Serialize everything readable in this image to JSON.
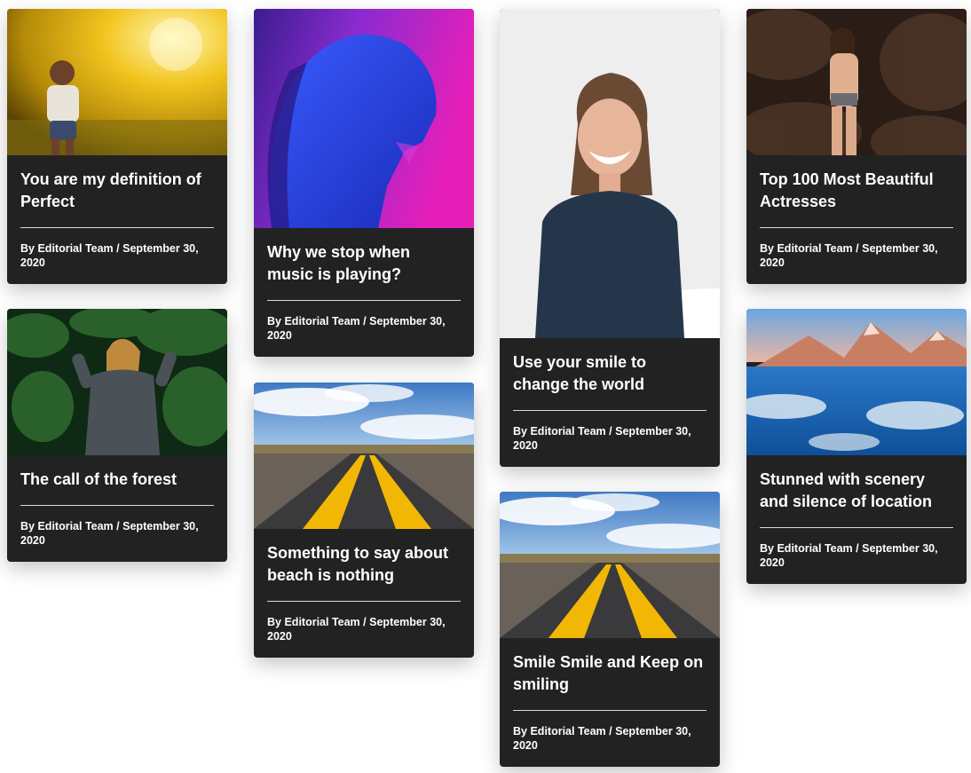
{
  "posts": [
    {
      "title": "You are my definition of Perfect",
      "author_prefix": "By",
      "author": "Editorial Team",
      "separator": "/",
      "date": "September 30, 2020",
      "image": "child-sprinkler-photo"
    },
    {
      "title": "Why we stop when music is playing?",
      "author_prefix": "By",
      "author": "Editorial Team",
      "separator": "/",
      "date": "September 30, 2020",
      "image": "neon-portrait-photo"
    },
    {
      "title": "Use your smile to change the world",
      "author_prefix": "By",
      "author": "Editorial Team",
      "separator": "/",
      "date": "September 30, 2020",
      "image": "smiling-woman-photo"
    },
    {
      "title": "Top 100 Most Beautiful Actresses",
      "author_prefix": "By",
      "author": "Editorial Team",
      "separator": "/",
      "date": "September 30, 2020",
      "image": "woman-rocks-photo"
    },
    {
      "title": "The call of the forest",
      "author_prefix": "By",
      "author": "Editorial Team",
      "separator": "/",
      "date": "September 30, 2020",
      "image": "forest-woman-photo"
    },
    {
      "title": "Something to say about beach is nothing",
      "author_prefix": "By",
      "author": "Editorial Team",
      "separator": "/",
      "date": "September 30, 2020",
      "image": "road-photo"
    },
    {
      "title": "Smile Smile and Keep on smiling",
      "author_prefix": "By",
      "author": "Editorial Team",
      "separator": "/",
      "date": "September 30, 2020",
      "image": "road-photo"
    },
    {
      "title": "Stunned with scenery and silence of location",
      "author_prefix": "By",
      "author": "Editorial Team",
      "separator": "/",
      "date": "September 30, 2020",
      "image": "mountain-lake-photo"
    }
  ],
  "colors": {
    "card_background": "#222222",
    "text": "#ffffff",
    "divider": "#d9d9d9",
    "page_background": "#ffffff"
  }
}
